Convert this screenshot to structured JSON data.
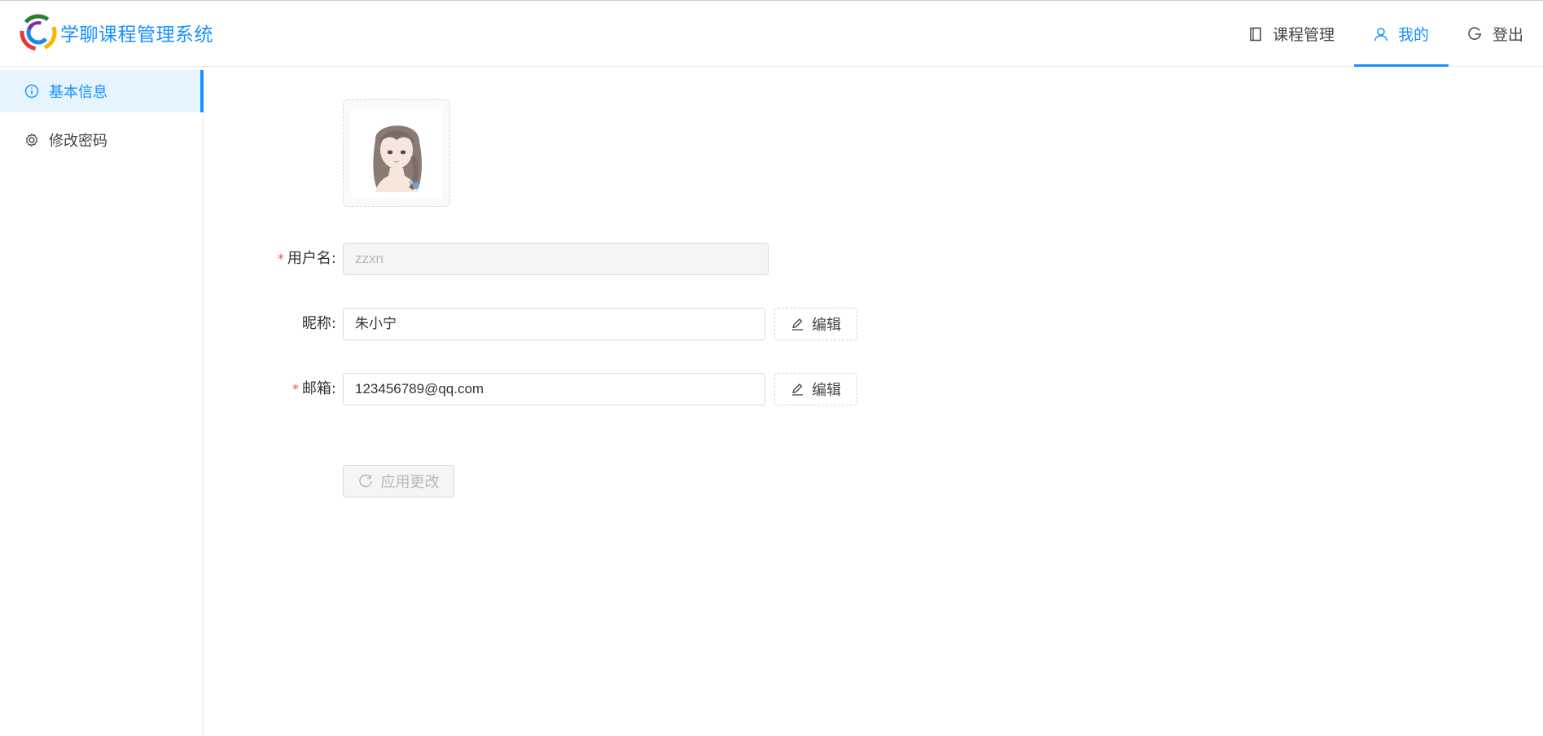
{
  "app": {
    "title": "学聊课程管理系统",
    "brand_color": "#1890ff"
  },
  "nav": {
    "items": [
      {
        "label": "课程管理",
        "icon": "book-icon",
        "active": false
      },
      {
        "label": "我的",
        "icon": "user-icon",
        "active": true
      },
      {
        "label": "登出",
        "icon": "logout-icon",
        "active": false
      }
    ]
  },
  "sidebar": {
    "items": [
      {
        "label": "基本信息",
        "icon": "info-circle-icon",
        "active": true
      },
      {
        "label": "修改密码",
        "icon": "gear-icon",
        "active": false
      }
    ]
  },
  "form": {
    "avatar": {
      "icon": "avatar-image"
    },
    "username": {
      "label": "用户名:",
      "required": true,
      "value": "zzxn",
      "disabled": true
    },
    "nickname": {
      "label": "昵称:",
      "required": false,
      "value": "朱小宁",
      "edit_label": "编辑"
    },
    "email": {
      "label": "邮箱:",
      "required": true,
      "value": "123456789@qq.com",
      "edit_label": "编辑"
    },
    "apply_label": "应用更改",
    "required_mark": "*"
  },
  "colors": {
    "accent": "#1890ff",
    "required": "#ff4d4f",
    "active_bg": "#e6f4ff",
    "disabled_bg": "#f5f5f5"
  }
}
